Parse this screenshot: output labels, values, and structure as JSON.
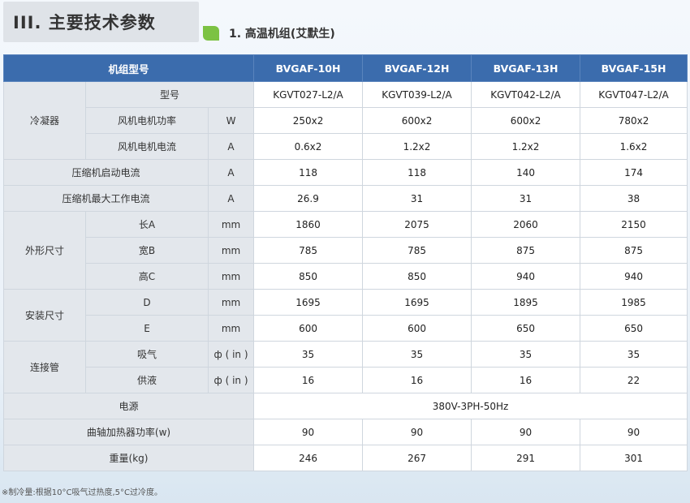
{
  "section_title": "III. 主要技术参数",
  "subtitle": "1. 高温机组(艾默生)",
  "header": {
    "model_label": "机组型号",
    "models": [
      "BVGAF-10H",
      "BVGAF-12H",
      "BVGAF-13H",
      "BVGAF-15H"
    ]
  },
  "rows": [
    {
      "group": "冷凝器",
      "label": "型号",
      "unit": "",
      "values": [
        "KGVT027-L2/A",
        "KGVT039-L2/A",
        "KGVT042-L2/A",
        "KGVT047-L2/A"
      ]
    },
    {
      "label": "风机电机功率",
      "unit": "W",
      "values": [
        "250x2",
        "600x2",
        "600x2",
        "780x2"
      ]
    },
    {
      "label": "风机电机电流",
      "unit": "A",
      "values": [
        "0.6x2",
        "1.2x2",
        "1.2x2",
        "1.6x2"
      ]
    },
    {
      "label": "压缩机启动电流",
      "unit": "A",
      "values": [
        "118",
        "118",
        "140",
        "174"
      ]
    },
    {
      "label": "压缩机最大工作电流",
      "unit": "A",
      "values": [
        "26.9",
        "31",
        "31",
        "38"
      ]
    },
    {
      "group": "外形尺寸",
      "label": "长A",
      "unit": "mm",
      "values": [
        "1860",
        "2075",
        "2060",
        "2150"
      ]
    },
    {
      "label": "宽B",
      "unit": "mm",
      "values": [
        "785",
        "785",
        "875",
        "875"
      ]
    },
    {
      "label": "高C",
      "unit": "mm",
      "values": [
        "850",
        "850",
        "940",
        "940"
      ]
    },
    {
      "group": "安装尺寸",
      "label": "D",
      "unit": "mm",
      "values": [
        "1695",
        "1695",
        "1895",
        "1985"
      ]
    },
    {
      "label": "E",
      "unit": "mm",
      "values": [
        "600",
        "600",
        "650",
        "650"
      ]
    },
    {
      "group": "连接管",
      "label": "吸气",
      "unit": "ф ( in )",
      "values": [
        "35",
        "35",
        "35",
        "35"
      ]
    },
    {
      "label": "供液",
      "unit": "ф ( in )",
      "values": [
        "16",
        "16",
        "16",
        "22"
      ]
    },
    {
      "label": "电源",
      "value_merged": "380V-3PH-50Hz"
    },
    {
      "label": "曲轴加热器功率(w)",
      "values": [
        "90",
        "90",
        "90",
        "90"
      ]
    },
    {
      "label": "重量(kg)",
      "values": [
        "246",
        "267",
        "291",
        "301"
      ]
    }
  ],
  "footnote": "※制冷量:根据10°C吸气过热度,5°C过冷度。",
  "colors": {
    "header_bg": "#3b6cad",
    "label_bg": "#e3e7ec",
    "accent_green": "#7cc243"
  }
}
